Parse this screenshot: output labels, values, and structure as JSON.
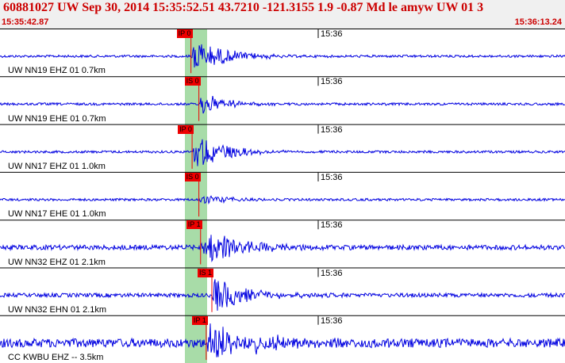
{
  "header": {
    "title": "60881027 UW Sep 30, 2014 15:35:52.51   43.7210 -121.3155  1.9 -0.87 Md le amyw UW 01   3",
    "start_time": "15:35:42.87",
    "end_time": "15:36:13.24"
  },
  "colors": {
    "trace": "#0000e0",
    "pick": "#ee0000",
    "window": "#a8dca8",
    "header_text": "#cc0000"
  },
  "channels": [
    {
      "label": "UW NN19 EHZ 01 0.7km",
      "minute_label": "15:36",
      "pick_label": "IP 0",
      "pick_time": 0.338
    },
    {
      "label": "UW NN19 EHE 01 0.7km",
      "minute_label": "15:36",
      "pick_label": "IS 0",
      "pick_time": 0.352
    },
    {
      "label": "UW NN17 EHZ 01 1.0km",
      "minute_label": "15:36",
      "pick_label": "IP 0",
      "pick_time": 0.34
    },
    {
      "label": "UW NN17 EHE 01 1.0km",
      "minute_label": "15:36",
      "pick_label": "IS 0",
      "pick_time": 0.352
    },
    {
      "label": "UW NN32 EHZ 01 2.1km",
      "minute_label": "15:36",
      "pick_label": "IP 1",
      "pick_time": 0.355
    },
    {
      "label": "UW NN32 EHN 01 2.1km",
      "minute_label": "15:36",
      "pick_label": "IS 1",
      "pick_time": 0.375
    },
    {
      "label": "CC KWBU EHZ -- 3.5km",
      "minute_label": "15:36",
      "pick_label": "IP 1",
      "pick_time": 0.365
    }
  ]
}
